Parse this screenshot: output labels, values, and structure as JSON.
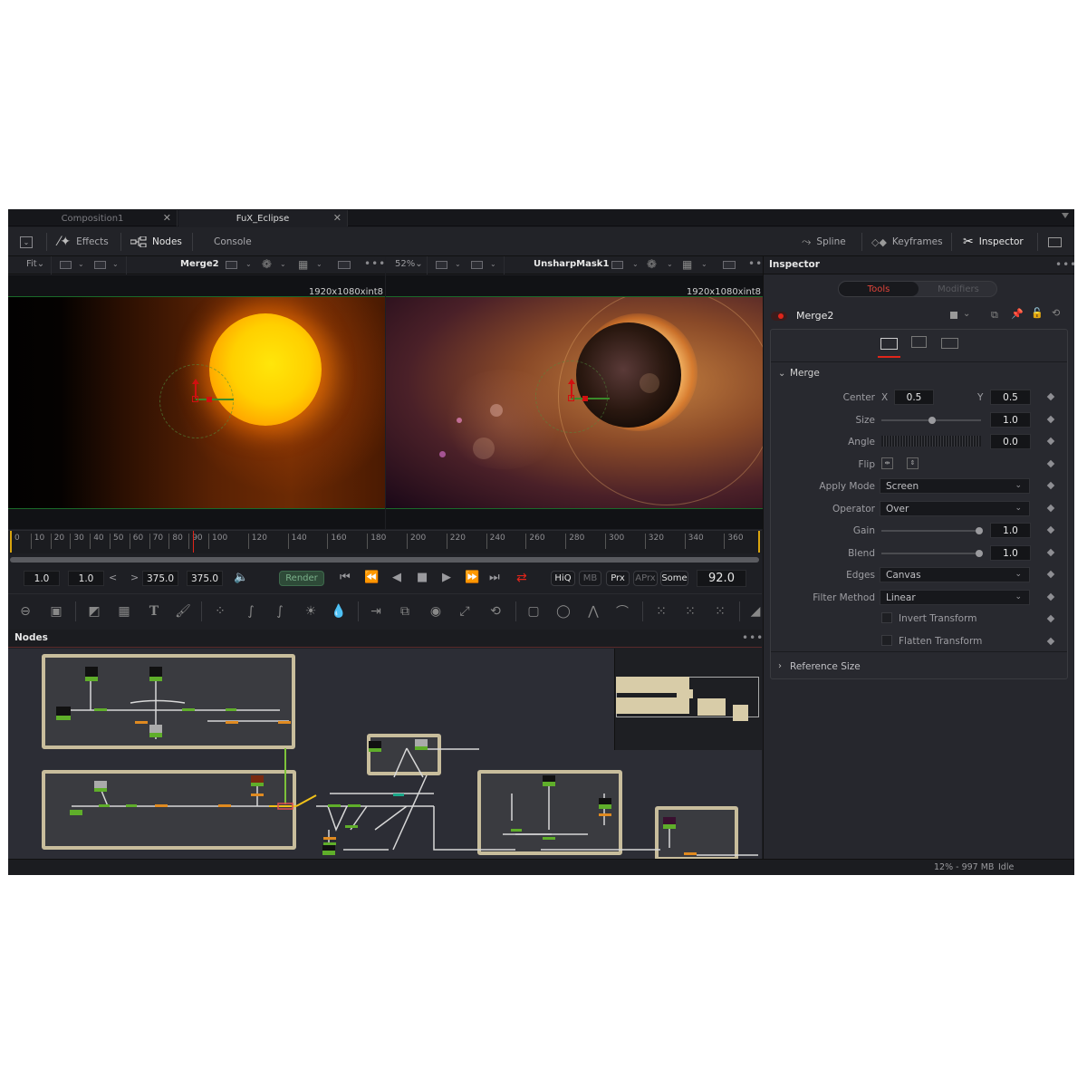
{
  "tabs": [
    {
      "label": "Composition1",
      "active": false
    },
    {
      "label": "FuX_Eclipse",
      "active": true
    }
  ],
  "toolbar": {
    "effects": "Effects",
    "nodes": "Nodes",
    "console": "Console",
    "spline": "Spline",
    "keyframes": "Keyframes",
    "inspector": "Inspector"
  },
  "viewer_left": {
    "zoom": "Fit",
    "title": "Merge2",
    "resolution": "1920x1080xint8"
  },
  "viewer_right": {
    "zoom": "52%",
    "title": "UnsharpMask1",
    "resolution": "1920x1080xint8"
  },
  "timeline": {
    "ticks": [
      "0",
      "10",
      "20",
      "30",
      "40",
      "50",
      "60",
      "70",
      "80",
      "90",
      "100",
      "120",
      "140",
      "160",
      "180",
      "200",
      "220",
      "240",
      "260",
      "280",
      "300",
      "320",
      "340",
      "360"
    ],
    "playhead_frame": 92
  },
  "transport": {
    "global_start": "1.0",
    "render_start": "1.0",
    "render_end": "375.0",
    "global_end": "375.0",
    "render_label": "Render",
    "hiq": "HiQ",
    "mb": "MB",
    "prx": "Prx",
    "aprx": "APrx",
    "some": "Some",
    "current_frame": "92.0"
  },
  "nodes_panel": {
    "title": "Nodes"
  },
  "inspector": {
    "title": "Inspector",
    "tab_tools": "Tools",
    "tab_modifiers": "Modifiers",
    "node_name": "Merge2",
    "section": "Merge",
    "center_label": "Center",
    "x_label": "X",
    "center_x": "0.5",
    "y_label": "Y",
    "center_y": "0.5",
    "size_label": "Size",
    "size_value": "1.0",
    "size_slider_fraction": 0.5,
    "angle_label": "Angle",
    "angle_value": "0.0",
    "flip_label": "Flip",
    "apply_mode_label": "Apply Mode",
    "apply_mode_value": "Screen",
    "operator_label": "Operator",
    "operator_value": "Over",
    "gain_label": "Gain",
    "gain_value": "1.0",
    "gain_slider_fraction": 1.0,
    "blend_label": "Blend",
    "blend_value": "1.0",
    "blend_slider_fraction": 1.0,
    "edges_label": "Edges",
    "edges_value": "Canvas",
    "filter_label": "Filter Method",
    "filter_value": "Linear",
    "invert_label": "Invert Transform",
    "flatten_label": "Flatten Transform",
    "reference_size": "Reference Size"
  },
  "status": {
    "memory": "12% -  997 MB",
    "state": "Idle"
  },
  "colors": {
    "accent_red": "#e0453a",
    "render_green": "#2e5a3c",
    "node_green": "#5fae2a",
    "group_frame": "#c8bd9c"
  }
}
